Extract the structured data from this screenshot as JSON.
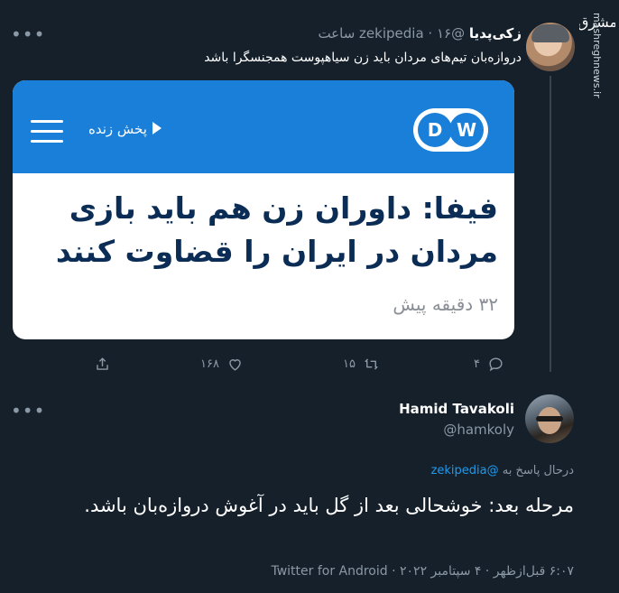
{
  "watermark": {
    "site": "mashreghnews.ir",
    "logo_text": "مشرق"
  },
  "tweet1": {
    "author_name": "زکی‌پدیا",
    "author_handle": "@zekipedia",
    "time": "۱۶ ساعت",
    "separator": "·",
    "text": "دروازه‌بان تیم‌های مردان باید زن سیاهپوست همجنسگرا باشد",
    "more_icon": "more-horizontal-icon"
  },
  "card": {
    "brand": "DW",
    "live_label": "پخش زنده",
    "headline": "فیفا: داوران زن هم باید بازی مردان در ایران را قضاوت کنند",
    "time_ago": "۳۲ دقیقه پیش",
    "colors": {
      "header": "#1a7fd8",
      "headline": "#0b2d55"
    }
  },
  "actions": {
    "replies": "۴",
    "retweets": "۱۵",
    "likes": "۱۶۸"
  },
  "tweet2": {
    "author_name": "Hamid Tavakoli",
    "author_handle": "@hamkoly",
    "reply_prefix": "درحال پاسخ به",
    "reply_handle": "@zekipedia",
    "text": "مرحله بعد: خوشحالی بعد از گل باید در آغوش دروازه‌بان باشد.",
    "meta": "۶:۰۷ قبل‌ازظهر · ۴ سپتامبر ۲۰۲۲ · Twitter for Android",
    "more_icon": "more-horizontal-icon"
  },
  "colors": {
    "background": "#15202b",
    "muted": "#8b98a5",
    "link": "#1d9bf0"
  }
}
